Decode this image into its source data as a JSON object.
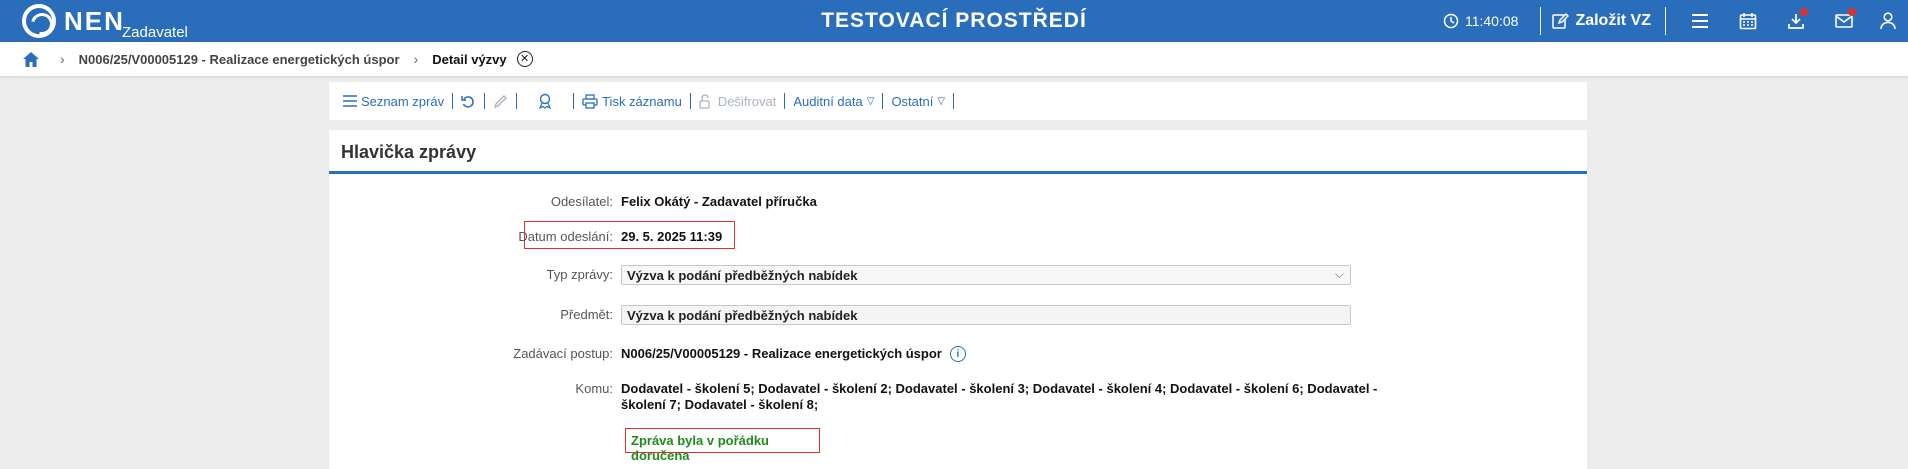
{
  "app": {
    "logo_text": "NEN",
    "logo_sub": "Zadavatel",
    "env_title": "TESTOVACÍ PROSTŘEDÍ"
  },
  "topbar": {
    "time": "11:40:08",
    "zalozit_label": "Založit VZ",
    "icons": [
      "menu-icon",
      "calendar-icon",
      "download-icon",
      "mail-icon",
      "user-icon"
    ],
    "accent": "#2a6ebb",
    "badge_color": "#e0302a"
  },
  "breadcrumb": {
    "link": "N006/25/V00005129 - Realizace energetických úspor",
    "current": "Detail výzvy"
  },
  "toolbar": {
    "seznam": "Seznam zpráv",
    "tisk": "Tisk záznamu",
    "desifrovat": "Dešifrovat",
    "auditni": "Auditní data",
    "ostatni": "Ostatní"
  },
  "panel": {
    "title": "Hlavička zprávy",
    "odesilatel_label": "Odesílatel:",
    "odesilatel_value": "Felix Okátý - Zadavatel příručka",
    "datum_label": "Datum odeslání:",
    "datum_value": "29. 5. 2025 11:39",
    "typ_label": "Typ zprávy:",
    "typ_value": "Výzva k podání předběžných nabídek",
    "predmet_label": "Předmět:",
    "predmet_value": "Výzva k podání předběžných nabídek",
    "postup_label": "Zadávací postup:",
    "postup_value": "N006/25/V00005129 - Realizace energetických úspor",
    "komu_label": "Komu:",
    "komu_line1": "Dodavatel - školení 5; Dodavatel - školení 2; Dodavatel - školení 3; Dodavatel - školení 4; Dodavatel - školení 6; Dodavatel -",
    "komu_line2": "školení 7; Dodavatel - školení 8;",
    "status": "Zpráva byla v pořádku doručena",
    "status_color": "#1f8b1f"
  }
}
